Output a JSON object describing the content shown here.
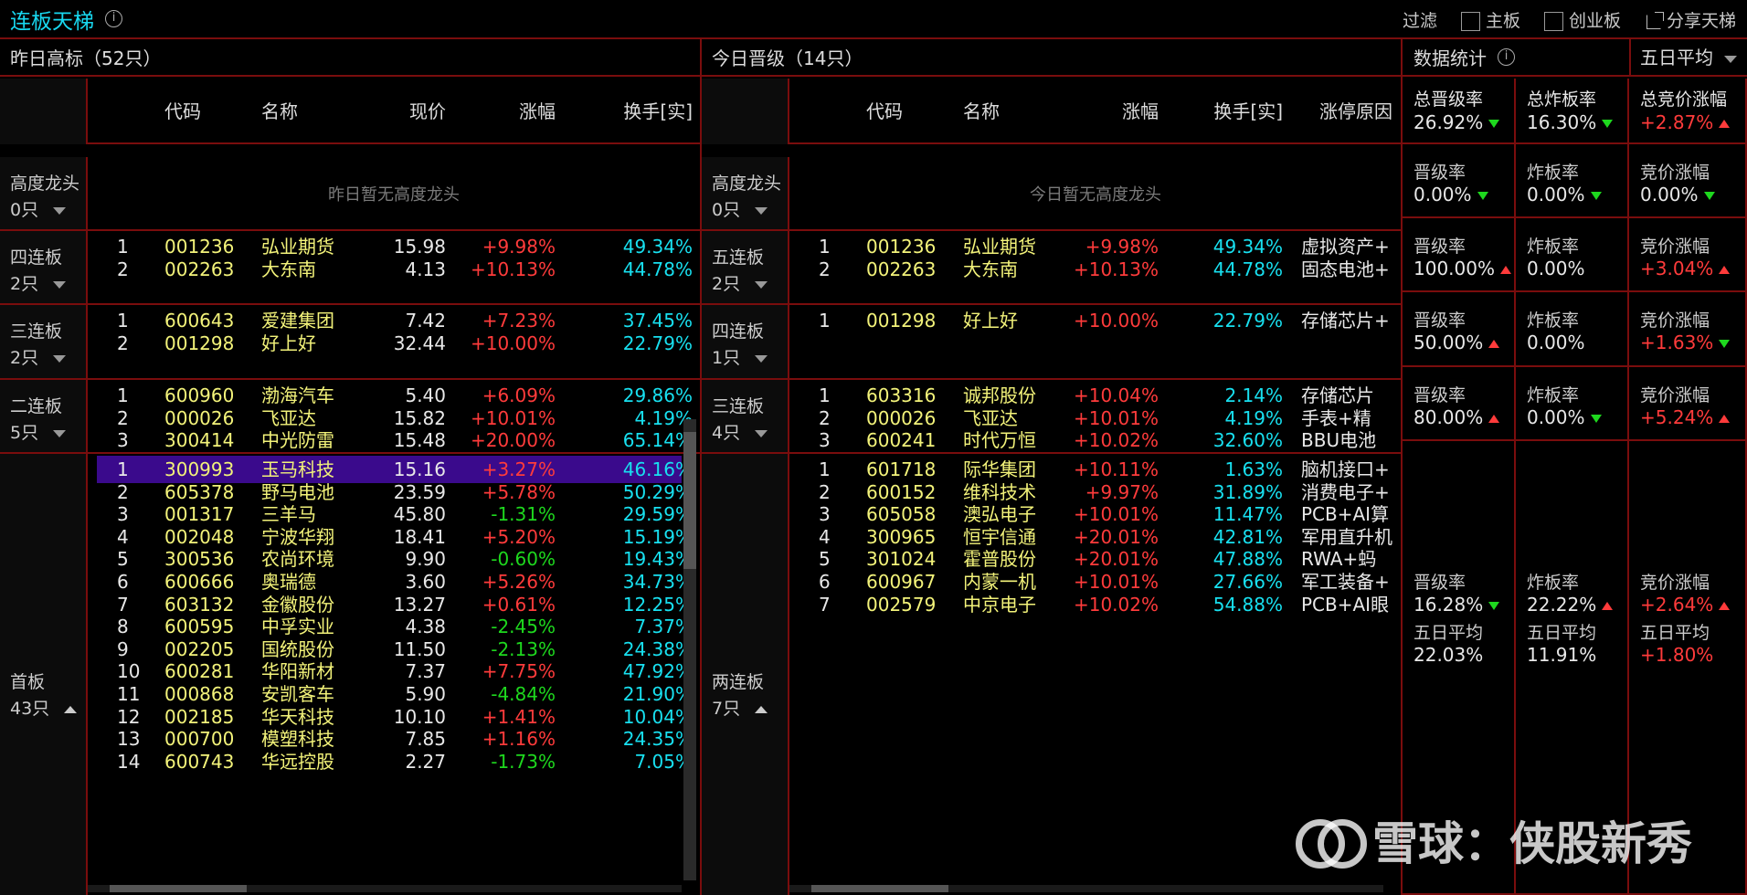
{
  "app": {
    "title": "连板天梯",
    "filter_label": "过滤",
    "filter_main": "主板",
    "filter_chinext": "创业板",
    "share": "分享天梯"
  },
  "left": {
    "title": "昨日高标（52只）",
    "headers": [
      "代码",
      "名称",
      "现价",
      "涨幅",
      "换手[实]"
    ],
    "empty_text": "昨日暂无高度龙头",
    "groups": [
      {
        "label": "高度龙头",
        "count": "0只",
        "collapsed": true,
        "rows": []
      },
      {
        "label": "四连板",
        "count": "2只",
        "collapsed": true,
        "rows": [
          [
            "1",
            "001236",
            "弘业期货",
            "15.98",
            "+9.98%",
            "49.34%"
          ],
          [
            "2",
            "002263",
            "大东南",
            "4.13",
            "+10.13%",
            "44.78%"
          ]
        ]
      },
      {
        "label": "三连板",
        "count": "2只",
        "collapsed": true,
        "rows": [
          [
            "1",
            "600643",
            "爱建集团",
            "7.42",
            "+7.23%",
            "37.45%"
          ],
          [
            "2",
            "001298",
            "好上好",
            "32.44",
            "+10.00%",
            "22.79%"
          ]
        ]
      },
      {
        "label": "二连板",
        "count": "5只",
        "collapsed": true,
        "rows": [
          [
            "1",
            "600960",
            "渤海汽车",
            "5.40",
            "+6.09%",
            "29.86%"
          ],
          [
            "2",
            "000026",
            "飞亚达",
            "15.82",
            "+10.01%",
            "4.19%"
          ],
          [
            "3",
            "300414",
            "中光防雷",
            "15.48",
            "+20.00%",
            "65.14%"
          ]
        ]
      },
      {
        "label": "首板",
        "count": "43只",
        "collapsed": false,
        "rows": [
          [
            "1",
            "300993",
            "玉马科技",
            "15.16",
            "+3.27%",
            "46.16%"
          ],
          [
            "2",
            "605378",
            "野马电池",
            "23.59",
            "+5.78%",
            "50.29%"
          ],
          [
            "3",
            "001317",
            "三羊马",
            "45.80",
            "-1.31%",
            "29.59%"
          ],
          [
            "4",
            "002048",
            "宁波华翔",
            "18.41",
            "+5.20%",
            "15.19%"
          ],
          [
            "5",
            "300536",
            "农尚环境",
            "9.90",
            "-0.60%",
            "19.43%"
          ],
          [
            "6",
            "600666",
            "奥瑞德",
            "3.60",
            "+5.26%",
            "34.73%"
          ],
          [
            "7",
            "603132",
            "金徽股份",
            "13.27",
            "+0.61%",
            "12.25%"
          ],
          [
            "8",
            "600595",
            "中孚实业",
            "4.38",
            "-2.45%",
            "7.37%"
          ],
          [
            "9",
            "002205",
            "国统股份",
            "11.50",
            "-2.13%",
            "24.38%"
          ],
          [
            "10",
            "600281",
            "华阳新材",
            "7.37",
            "+7.75%",
            "47.92%"
          ],
          [
            "11",
            "000868",
            "安凯客车",
            "5.90",
            "-4.84%",
            "21.90%"
          ],
          [
            "12",
            "002185",
            "华天科技",
            "10.10",
            "+1.41%",
            "10.04%"
          ],
          [
            "13",
            "000700",
            "模塑科技",
            "7.85",
            "+1.16%",
            "24.35%"
          ],
          [
            "14",
            "600743",
            "华远控股",
            "2.27",
            "-1.73%",
            "7.05%"
          ]
        ]
      }
    ]
  },
  "mid": {
    "title": "今日晋级（14只）",
    "headers": [
      "代码",
      "名称",
      "涨幅",
      "换手[实]",
      "涨停原因"
    ],
    "empty_text": "今日暂无高度龙头",
    "groups": [
      {
        "label": "高度龙头",
        "count": "0只",
        "rows": []
      },
      {
        "label": "五连板",
        "count": "2只",
        "rows": [
          [
            "1",
            "001236",
            "弘业期货",
            "+9.98%",
            "49.34%",
            "虚拟资产+"
          ],
          [
            "2",
            "002263",
            "大东南",
            "+10.13%",
            "44.78%",
            "固态电池+"
          ]
        ]
      },
      {
        "label": "四连板",
        "count": "1只",
        "rows": [
          [
            "1",
            "001298",
            "好上好",
            "+10.00%",
            "22.79%",
            "存储芯片+"
          ]
        ]
      },
      {
        "label": "三连板",
        "count": "4只",
        "rows": [
          [
            "1",
            "603316",
            "诚邦股份",
            "+10.04%",
            "2.14%",
            "存储芯片"
          ],
          [
            "2",
            "000026",
            "飞亚达",
            "+10.01%",
            "4.19%",
            "手表+精"
          ],
          [
            "3",
            "600241",
            "时代万恒",
            "+10.02%",
            "32.60%",
            "BBU电池"
          ]
        ]
      },
      {
        "label": "两连板",
        "count": "7只",
        "rows": [
          [
            "1",
            "601718",
            "际华集团",
            "+10.11%",
            "1.63%",
            "脑机接口+"
          ],
          [
            "2",
            "600152",
            "维科技术",
            "+9.97%",
            "31.89%",
            "消费电子+"
          ],
          [
            "3",
            "605058",
            "澳弘电子",
            "+10.01%",
            "11.47%",
            "PCB+AI算"
          ],
          [
            "4",
            "300965",
            "恒宇信通",
            "+20.01%",
            "42.81%",
            "军用直升机"
          ],
          [
            "5",
            "301024",
            "霍普股份",
            "+20.01%",
            "47.88%",
            "RWA+蚂"
          ],
          [
            "6",
            "600967",
            "内蒙一机",
            "+10.01%",
            "27.66%",
            "军工装备+"
          ],
          [
            "7",
            "002579",
            "中京电子",
            "+10.02%",
            "54.88%",
            "PCB+AI眼"
          ]
        ]
      }
    ]
  },
  "stats": {
    "title": "数据统计",
    "avg_select": "五日平均",
    "summary": [
      {
        "k": "总晋级率",
        "v": "26.92%",
        "dir": "down"
      },
      {
        "k": "总炸板率",
        "v": "16.30%",
        "dir": "down"
      },
      {
        "k": "总竞价涨幅",
        "v": "+2.87%",
        "dir": "up"
      }
    ],
    "rows": [
      [
        {
          "k": "晋级率",
          "v": "0.00%",
          "dir": "down"
        },
        {
          "k": "炸板率",
          "v": "0.00%",
          "dir": "down"
        },
        {
          "k": "竞价涨幅",
          "v": "0.00%",
          "dir": "down"
        }
      ],
      [
        {
          "k": "晋级率",
          "v": "100.00%",
          "dir": "up"
        },
        {
          "k": "炸板率",
          "v": "0.00%",
          "dir": ""
        },
        {
          "k": "竞价涨幅",
          "v": "+3.04%",
          "dir": "up"
        }
      ],
      [
        {
          "k": "晋级率",
          "v": "50.00%",
          "dir": "up"
        },
        {
          "k": "炸板率",
          "v": "0.00%",
          "dir": ""
        },
        {
          "k": "竞价涨幅",
          "v": "+1.63%",
          "dir": "down"
        }
      ],
      [
        {
          "k": "晋级率",
          "v": "80.00%",
          "dir": "up"
        },
        {
          "k": "炸板率",
          "v": "0.00%",
          "dir": "down"
        },
        {
          "k": "竞价涨幅",
          "v": "+5.24%",
          "dir": "up"
        }
      ]
    ],
    "last": [
      {
        "k": "晋级率",
        "v": "16.28%",
        "dir": "down",
        "ak": "五日平均",
        "av": "22.03%"
      },
      {
        "k": "炸板率",
        "v": "22.22%",
        "dir": "up",
        "ak": "五日平均",
        "av": "11.91%"
      },
      {
        "k": "竞价涨幅",
        "v": "+2.64%",
        "dir": "up",
        "ak": "五日平均",
        "av": "+1.80%"
      }
    ]
  },
  "watermark": "雪球：侠股新秀",
  "colors": {
    "border": "#7a0d0d",
    "up": "#ff3b3b",
    "down": "#1ed81e",
    "code": "#f3f37a",
    "turnover": "#18e0f0",
    "title": "#18d8f0",
    "selected": "#3a0a8c"
  }
}
